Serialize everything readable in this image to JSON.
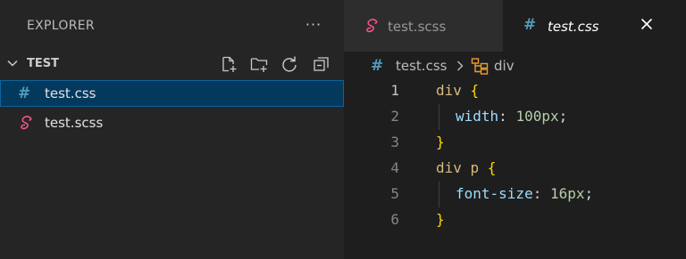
{
  "sidebar": {
    "title": "EXPLORER",
    "more_label": "···",
    "folder": {
      "name": "TEST"
    },
    "toolbar": [
      {
        "icon": "new-file-icon"
      },
      {
        "icon": "new-folder-icon"
      },
      {
        "icon": "refresh-icon"
      },
      {
        "icon": "collapse-all-icon"
      }
    ],
    "files": [
      {
        "name": "test.css",
        "icon": "css-hash-icon",
        "selected": true
      },
      {
        "name": "test.scss",
        "icon": "sass-icon",
        "selected": false
      }
    ]
  },
  "editor": {
    "tabs": [
      {
        "label": "test.scss",
        "icon": "sass-icon",
        "active": false
      },
      {
        "label": "test.css",
        "icon": "css-hash-icon",
        "active": true,
        "close": "close-icon"
      }
    ],
    "breadcrumb": {
      "file_icon": "#",
      "file": "test.css",
      "separator": "chevron-right-icon",
      "symbol_icon": "symbol-class-icon",
      "symbol": "div"
    },
    "lines": [
      {
        "number": "1",
        "text": "div {"
      },
      {
        "number": "2",
        "text": "width: 100px;"
      },
      {
        "number": "3",
        "text": "}"
      },
      {
        "number": "4",
        "text": "div p {"
      },
      {
        "number": "5",
        "text": "font-size: 16px;"
      },
      {
        "number": "6",
        "text": "}"
      }
    ],
    "tokens": {
      "l1_sel": "div ",
      "l1_brace": "{",
      "l2_prop": "width",
      "l2_colon": ": ",
      "l2_num": "100px",
      "l2_semi": ";",
      "l3_brace": "}",
      "l4_sel": "div p ",
      "l4_brace": "{",
      "l5_prop": "font-size",
      "l5_colon": ": ",
      "l5_num": "16px",
      "l5_semi": ";",
      "l6_brace": "}"
    }
  },
  "colors": {
    "selection_bg": "#04395e",
    "selection_border": "#0e639c",
    "css_icon": "#519aba",
    "sass_icon": "#f55385",
    "selector": "#d7ba7d",
    "brace": "#ffd700",
    "property": "#9cdcfe",
    "number": "#b5cea8"
  }
}
